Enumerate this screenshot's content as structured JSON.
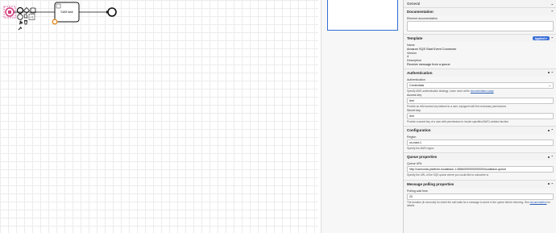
{
  "diagram": {
    "task_label": "SAM task",
    "context_pad": {
      "wrench_icon": "wrench-icon",
      "trash_icon": "trash-icon",
      "append_icon": "append-icon"
    }
  },
  "panel": {
    "general": {
      "title": "General"
    },
    "documentation": {
      "title": "Documentation",
      "element_doc_label": "Element documentation",
      "element_doc_value": ""
    },
    "template": {
      "title": "Template",
      "badge": "Applied ▾",
      "name_label": "Name",
      "name_value": "Amazon SQS Start Event Connector",
      "version_label": "Version",
      "version_value": "4",
      "description_label": "Description",
      "description_value": "Receive message from a queue"
    },
    "authentication": {
      "title": "Authentication",
      "auth_label": "Authentication",
      "auth_value": "Credentials",
      "auth_hint": "Specify AWS authentication strategy. Learn more at the",
      "auth_hint_link": "documentation page",
      "access_key_label": "Access key",
      "access_key_value": "test",
      "access_key_hint": "Provide an IAM access key tailored to a user, equipped with the necessary permissions",
      "secret_key_label": "Secret key",
      "secret_key_value": "test",
      "secret_key_hint": "Provide a secret key of a user with permissions to invoke specified AWS Lambda function"
    },
    "configuration": {
      "title": "Configuration",
      "region_label": "Region",
      "region_value": "us-east-1",
      "region_hint": "Specify the AWS region"
    },
    "queue": {
      "title": "Queue properties",
      "url_label": "Queue URL",
      "url_value": "http://camunda-platform-localstack-1:4566/000000000000/localstack-queue",
      "url_hint": "Specify the URL of the SQS queue where you would like to subscribe to"
    },
    "polling": {
      "title": "Message polling properties",
      "wait_label": "Polling wait time",
      "wait_value": "20",
      "wait_hint": "The duration (in seconds) for which the call waits for a message to arrive in the queue before returning. See",
      "wait_hint_link": "documentation",
      "wait_hint_tail": "for details"
    }
  }
}
